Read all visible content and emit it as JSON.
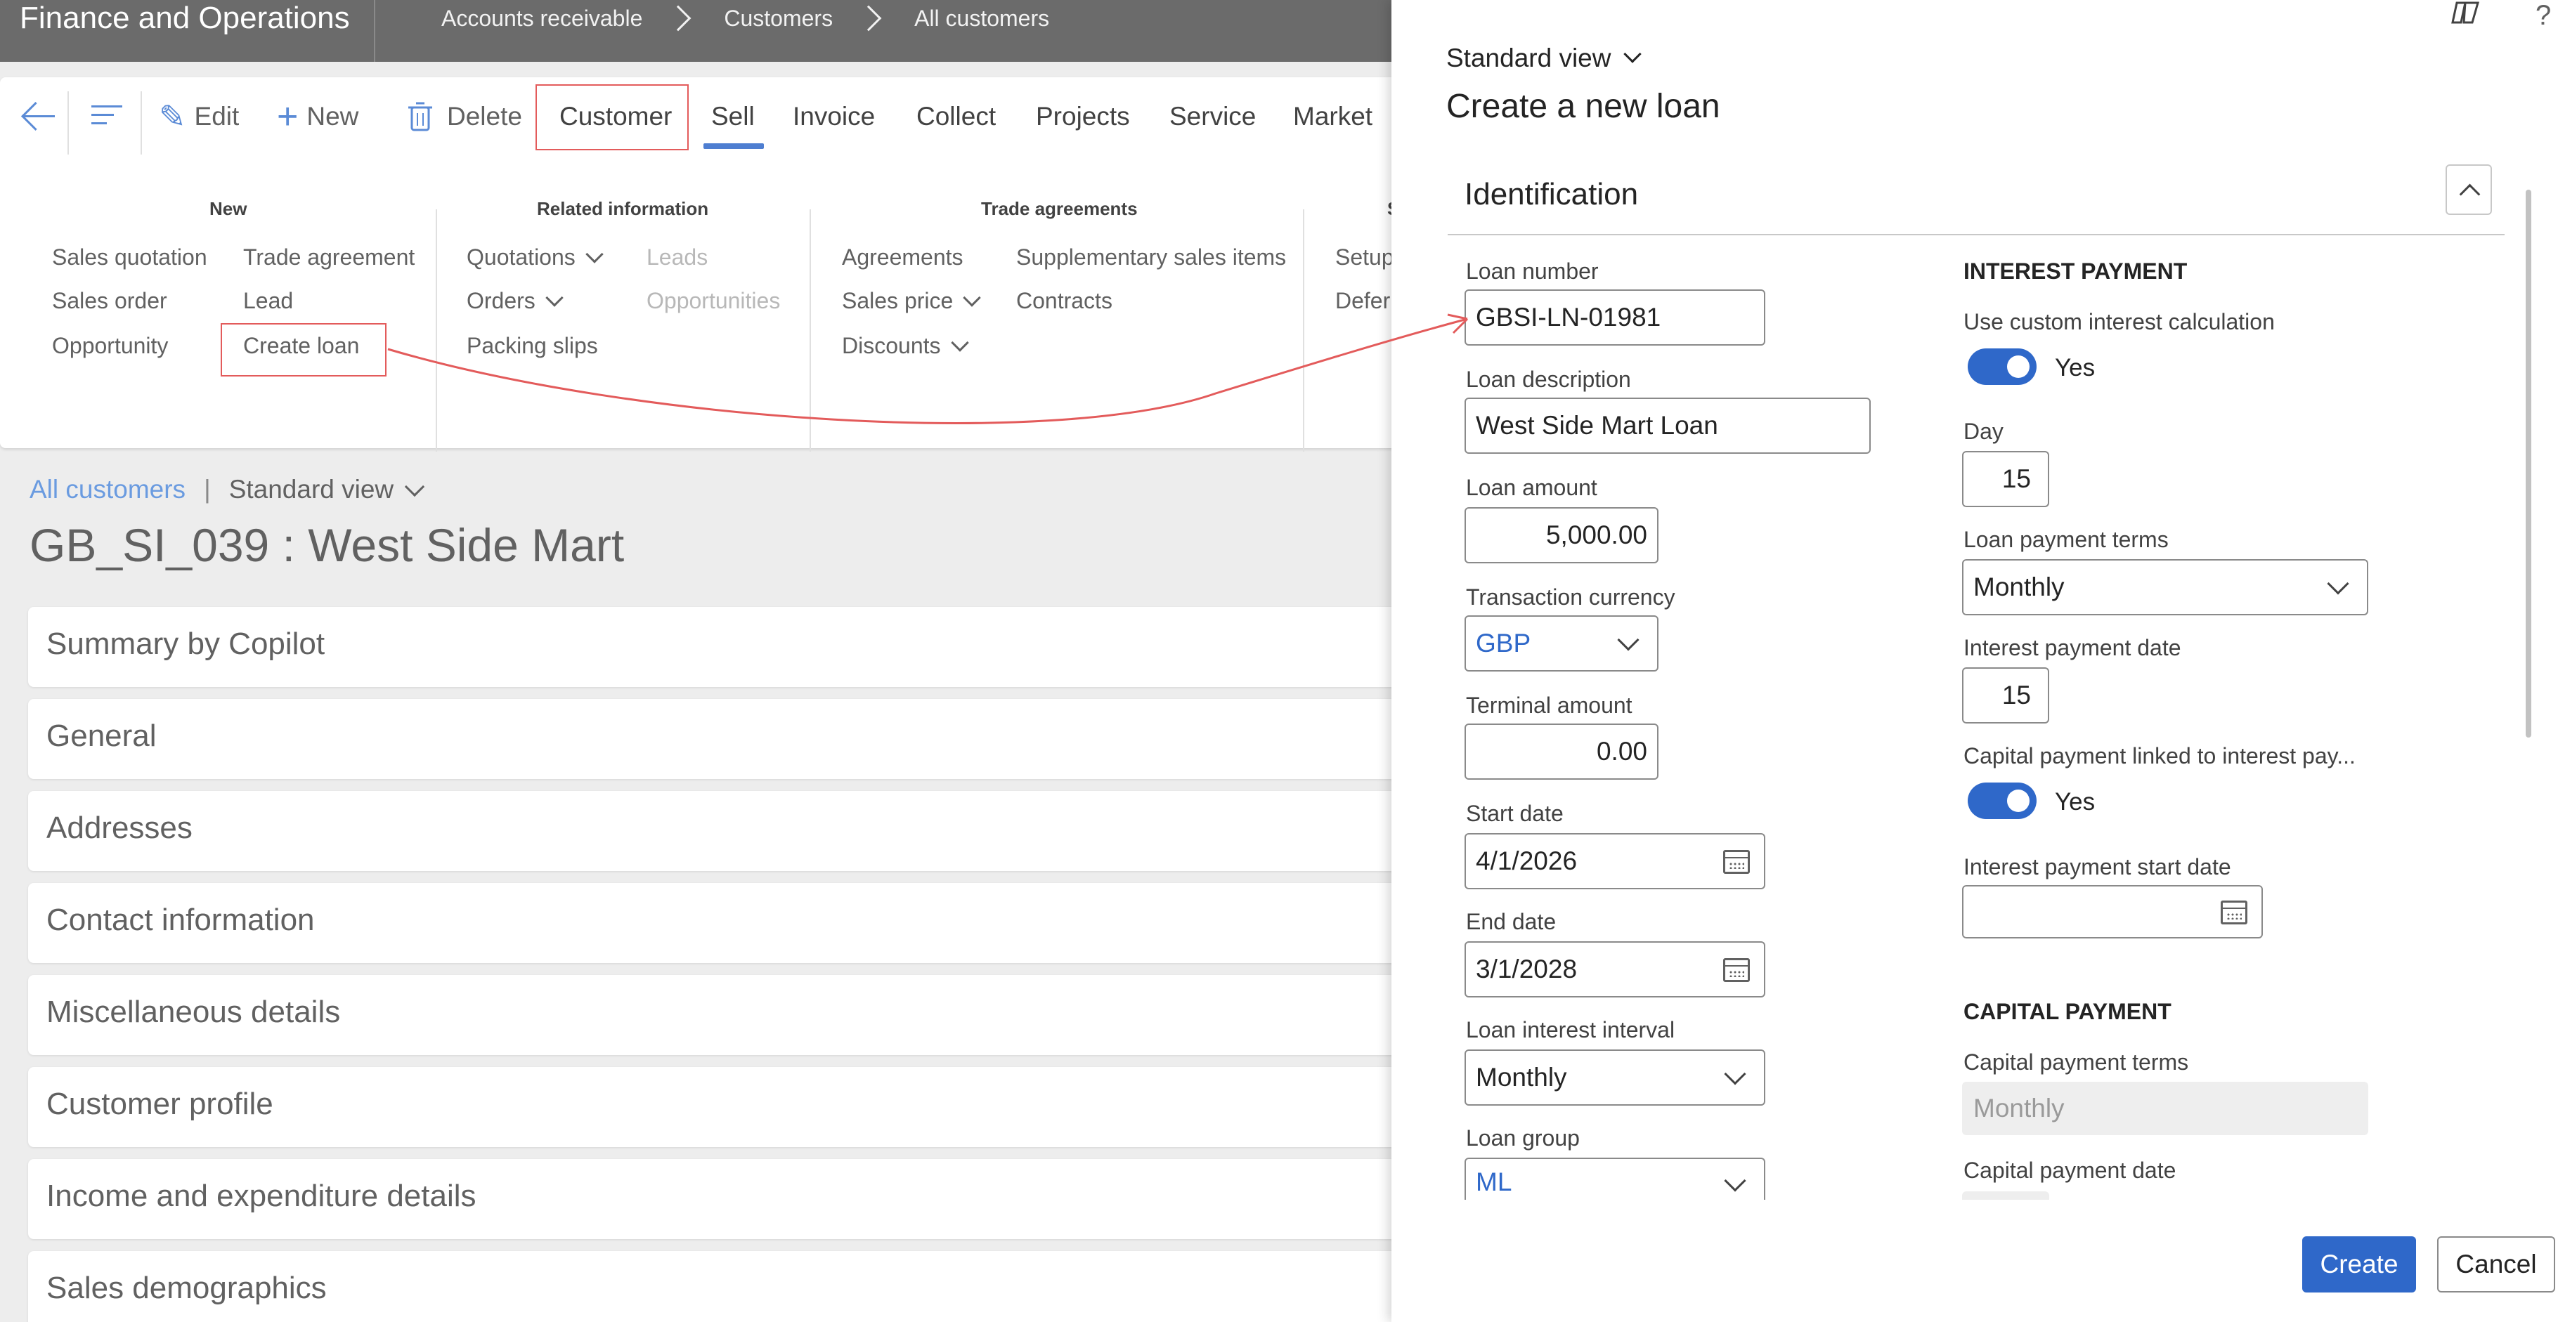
{
  "topbar": {
    "app_title": "Finance and Operations",
    "breadcrumb": [
      "Accounts receivable",
      "Customers",
      "All customers"
    ]
  },
  "toolbar": {
    "edit": "Edit",
    "new": "New",
    "delete": "Delete",
    "tabs": [
      "Customer",
      "Sell",
      "Invoice",
      "Collect",
      "Projects",
      "Service",
      "Market"
    ],
    "active_tab": "Sell"
  },
  "action_groups": {
    "new": {
      "title": "New",
      "items": [
        "Sales quotation",
        "Sales order",
        "Opportunity",
        "Trade agreement",
        "Lead",
        "Create loan"
      ]
    },
    "related": {
      "title": "Related information",
      "items": [
        "Quotations",
        "Orders",
        "Packing slips",
        "Leads",
        "Opportunities"
      ]
    },
    "trade": {
      "title": "Trade agreements",
      "items": [
        "Agreements",
        "Sales price",
        "Discounts",
        "Supplementary sales items",
        "Contracts"
      ]
    },
    "partial": {
      "title": "S",
      "items": [
        "Setup",
        "Defer"
      ]
    }
  },
  "main": {
    "breadcrumb_link": "All customers",
    "separator": "|",
    "view_name": "Standard view",
    "record_title": "GB_SI_039 : West Side Mart",
    "fasttabs": [
      "Summary by Copilot",
      "General",
      "Addresses",
      "Contact information",
      "Miscellaneous details",
      "Customer profile",
      "Income and expenditure details",
      "Sales demographics"
    ]
  },
  "panel": {
    "view_name": "Standard view",
    "title": "Create a new loan",
    "help": "?",
    "section_title": "Identification",
    "fields": {
      "loan_number": {
        "label": "Loan number",
        "value": "GBSI-LN-01981"
      },
      "loan_description": {
        "label": "Loan description",
        "value": "West Side Mart Loan"
      },
      "loan_amount": {
        "label": "Loan amount",
        "value": "5,000.00"
      },
      "transaction_currency": {
        "label": "Transaction currency",
        "value": "GBP"
      },
      "terminal_amount": {
        "label": "Terminal amount",
        "value": "0.00"
      },
      "start_date": {
        "label": "Start date",
        "value": "4/1/2026"
      },
      "end_date": {
        "label": "End date",
        "value": "3/1/2028"
      },
      "loan_interest_interval": {
        "label": "Loan interest interval",
        "value": "Monthly"
      },
      "loan_group": {
        "label": "Loan group",
        "value": "ML"
      }
    },
    "interest": {
      "heading": "INTEREST PAYMENT",
      "custom_calc_label": "Use custom interest calculation",
      "custom_calc_value": "Yes",
      "day_label": "Day",
      "day_value": "15",
      "terms_label": "Loan payment terms",
      "terms_value": "Monthly",
      "date_label": "Interest payment date",
      "date_value": "15",
      "linked_label": "Capital payment linked to interest pay...",
      "linked_value": "Yes",
      "start_label": "Interest payment start date",
      "start_value": ""
    },
    "capital": {
      "heading": "CAPITAL PAYMENT",
      "terms_label": "Capital payment terms",
      "terms_value": "Monthly",
      "date_label": "Capital payment date"
    },
    "buttons": {
      "create": "Create",
      "cancel": "Cancel"
    }
  },
  "colors": {
    "accent": "#2f68c9",
    "annotation": "#e35b5b",
    "topbar": "#6b6b6b"
  }
}
